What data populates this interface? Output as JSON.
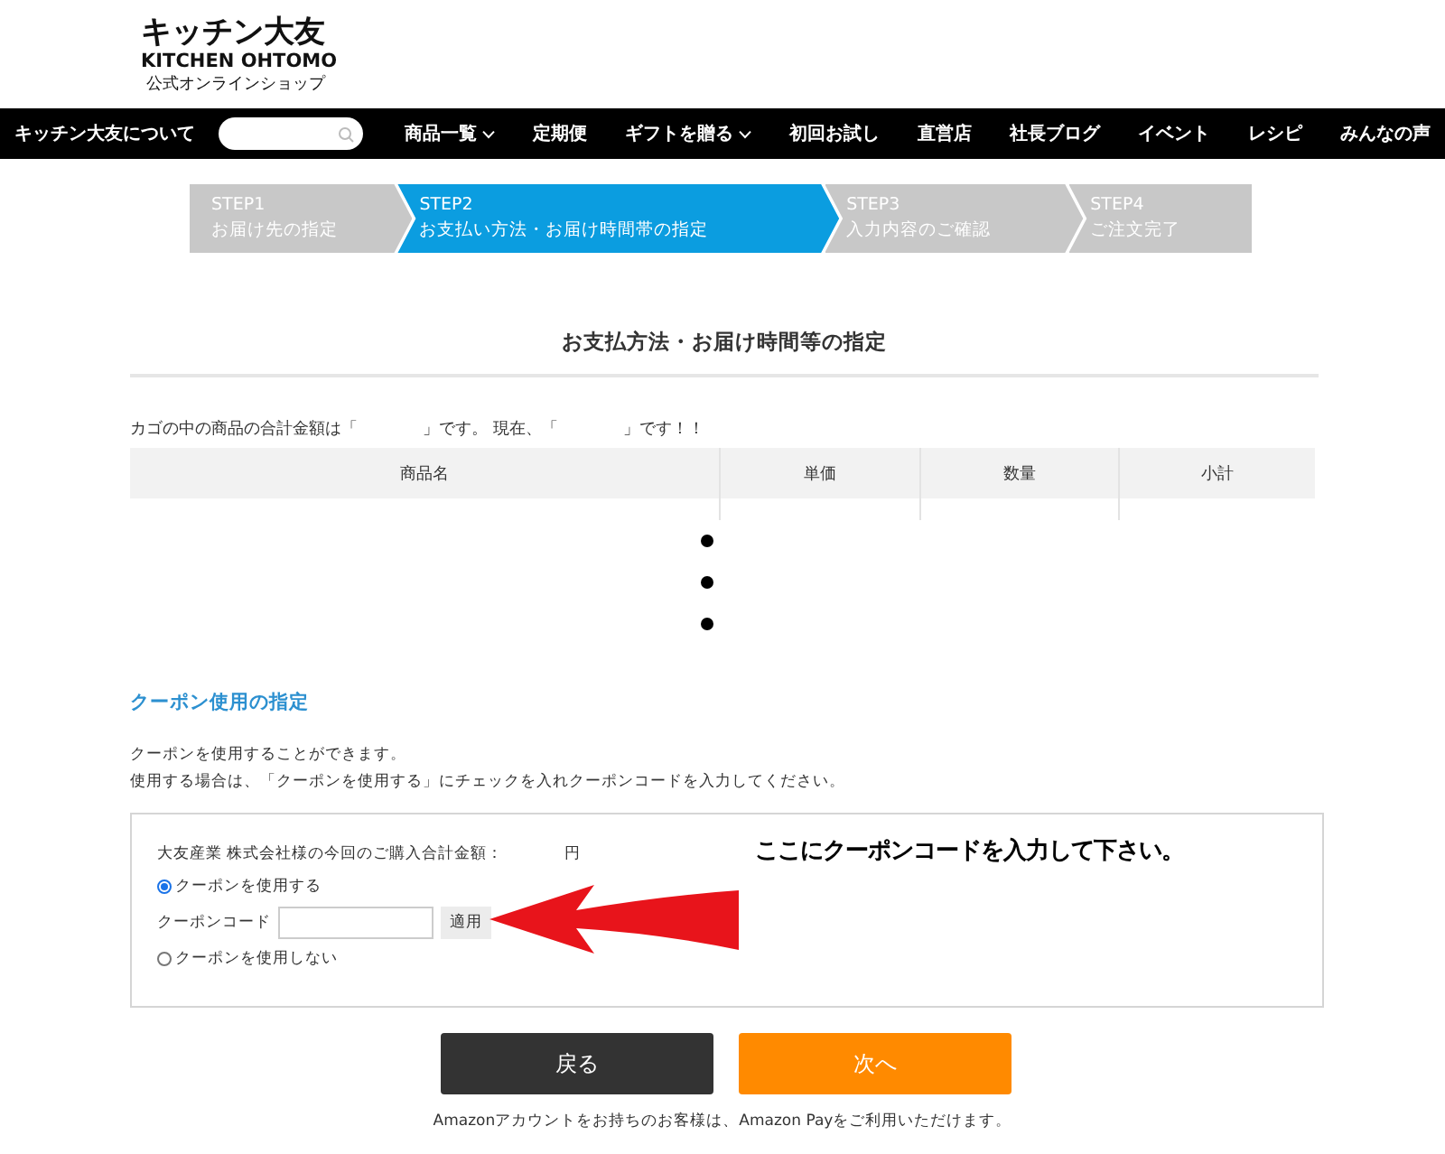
{
  "logo": {
    "name": "キッチン大友",
    "latin": "KITCHEN OHTOMO",
    "tagline": "公式オンラインショップ"
  },
  "nav": {
    "items": [
      {
        "label": "キッチン大友について",
        "kind": "link"
      },
      {
        "label": "商品一覧",
        "kind": "dropdown"
      },
      {
        "label": "定期便",
        "kind": "link"
      },
      {
        "label": "ギフトを贈る",
        "kind": "dropdown"
      },
      {
        "label": "初回お試し",
        "kind": "link"
      },
      {
        "label": "直営店",
        "kind": "link"
      },
      {
        "label": "社長ブログ",
        "kind": "link"
      },
      {
        "label": "イベント",
        "kind": "link"
      },
      {
        "label": "レシピ",
        "kind": "link"
      },
      {
        "label": "みんなの声",
        "kind": "link"
      }
    ]
  },
  "steps": [
    {
      "step": "STEP1",
      "label": "お届け先の指定",
      "selected": false
    },
    {
      "step": "STEP2",
      "label": "お支払い方法・お届け時間帯の指定",
      "selected": true
    },
    {
      "step": "STEP3",
      "label": "入力内容のご確認",
      "selected": false
    },
    {
      "step": "STEP4",
      "label": "ご注文完了",
      "selected": false
    }
  ],
  "page_title": "お支払方法・お届け時間等の指定",
  "cart_summary": "カゴの中の商品の合計金額は「　　　　」です。 現在、「　　　　」です！！",
  "table": {
    "columns": [
      "商品名",
      "単価",
      "数量",
      "小計"
    ]
  },
  "coupon": {
    "heading": "クーポン使用の指定",
    "description": [
      "クーポンを使用することができます。",
      "使用する場合は、「クーポンを使用する」にチェックを入れクーポンコードを入力してください。"
    ],
    "total_label": "大友産業 株式会社様の今回のご購入合計金額：",
    "currency": "円",
    "options": [
      {
        "label": "クーポンを使用する",
        "selected": true
      },
      {
        "label": "クーポンを使用しない",
        "selected": false
      }
    ],
    "code_label": "クーポンコード",
    "apply_button": "適用"
  },
  "buttons": {
    "back": "戻る",
    "next": "次へ"
  },
  "note": "Amazonアカウントをお持ちのお客様は、Amazon Payをご利用いただけます。",
  "annotation": {
    "text": "ここにクーポンコードを入力して下さい。"
  }
}
